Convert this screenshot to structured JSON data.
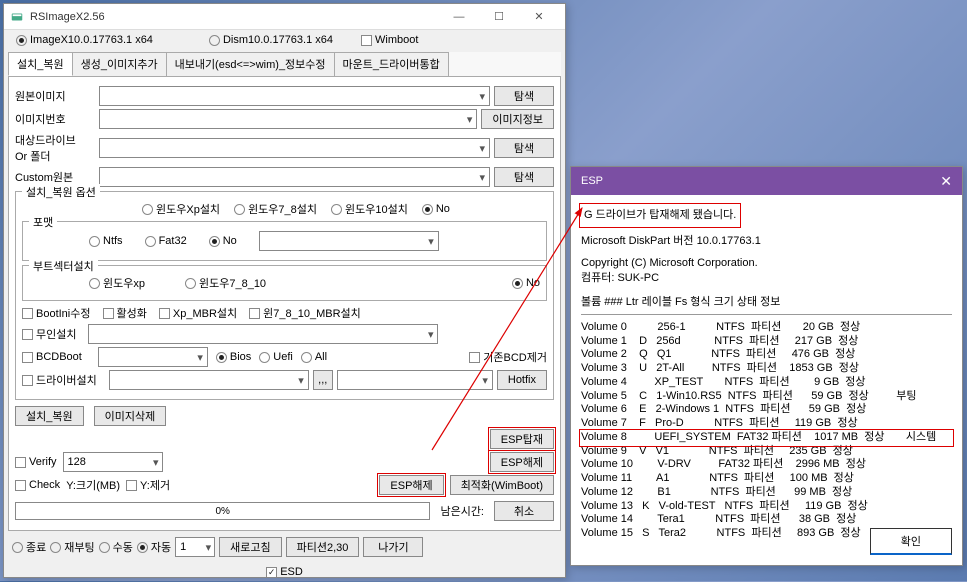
{
  "main": {
    "title": "RSImageX2.56",
    "modes": {
      "imagex": "ImageX10.0.17763.1 x64",
      "dism": "Dism10.0.17763.1 x64",
      "wimboot": "Wimboot"
    },
    "tabs": {
      "t0": "설치_복원",
      "t1": "생성_이미지추가",
      "t2": "내보내기(esd<=>wim)_정보수정",
      "t3": "마운트_드라이버통합"
    },
    "labels": {
      "src": "원본이미지",
      "imgno": "이미지번호",
      "target": "대상드라이브\nOr 폴더",
      "custom": "Custom원본",
      "browse": "탐색",
      "imginfo": "이미지정보",
      "options": "설치_복원 옵션",
      "winxp": "윈도우Xp설치",
      "win78": "윈도우7_8설치",
      "win10": "윈도우10설치",
      "no": "No",
      "format": "포맷",
      "ntfs": "Ntfs",
      "fat32": "Fat32",
      "bootsector": "부트섹터설치",
      "bsxp": "윈도우xp",
      "bs78": "윈도우7_8_10",
      "bootini": "BootIni수정",
      "activate": "활성화",
      "xpmbr": "Xp_MBR설치",
      "win78mbr": "윈7_8_10_MBR설치",
      "noattend": "무인설치",
      "bcdboot": "BCDBoot",
      "bios": "Bios",
      "uefi": "Uefi",
      "all": "All",
      "bcdremove": "기존BCD제거",
      "driver": "드라이버설치",
      "hotfix": "Hotfix",
      "install": "설치_복원",
      "imgdel": "이미지삭제",
      "espmount": "ESP탑재",
      "verify": "Verify",
      "v128": "128",
      "espunmount": "ESP해제",
      "check": "Check",
      "ysize": "Y:크기(MB)",
      "yremove": "Y:제거",
      "optimize": "최적화(WimBoot)",
      "progress": "0%",
      "remaining": "남은시간:",
      "cancel": "취소",
      "shutdown": "종료",
      "reboot": "재부팅",
      "manual": "수동",
      "auto": "자동",
      "one": "1",
      "refresh": "새로고침",
      "partition": "파티션2,30",
      "exit": "나가기",
      "esd": "ESD",
      "ellipsis": ",,,"
    }
  },
  "esp": {
    "title": "ESP",
    "msg": "G 드라이브가 탑재해제 됐습니다.",
    "diskpart": "Microsoft DiskPart 버전 10.0.17763.1",
    "copyright": "Copyright (C) Microsoft Corporation.",
    "computer": "컴퓨터: SUK-PC",
    "header": "볼륨 ### Ltr 레이블     Fs   형식   크기   상태       정보",
    "volumes": [
      "Volume 0          256-1          NTFS  파티션       20 GB  정상",
      "Volume 1    D   256d           NTFS  파티션     217 GB  정상",
      "Volume 2    Q   Q1             NTFS  파티션     476 GB  정상",
      "Volume 3    U   2T-All         NTFS  파티션    1853 GB  정상",
      "Volume 4         XP_TEST       NTFS  파티션        9 GB  정상",
      "Volume 5    C   1-Win10.RS5  NTFS  파티션      59 GB  정상         부팅",
      "Volume 6    E   2-Windows 1  NTFS  파티션      59 GB  정상",
      "Volume 7    F   Pro-D          NTFS  파티션     119 GB  정상",
      "Volume 8         UEFI_SYSTEM  FAT32 파티션    1017 MB  정상       시스템",
      "Volume 9    V   V1             NTFS  파티션     235 GB  정상",
      "Volume 10        V-DRV         FAT32 파티션    2996 MB  정상",
      "Volume 11        A1             NTFS  파티션     100 MB  정상",
      "Volume 12        B1             NTFS  파티션      99 MB  정상",
      "Volume 13   K   V-old-TEST   NTFS  파티션     119 GB  정상",
      "Volume 14        Tera1          NTFS  파티션      38 GB  정상",
      "Volume 15   S   Tera2          NTFS  파티션     893 GB  정상"
    ],
    "ok": "확인"
  }
}
